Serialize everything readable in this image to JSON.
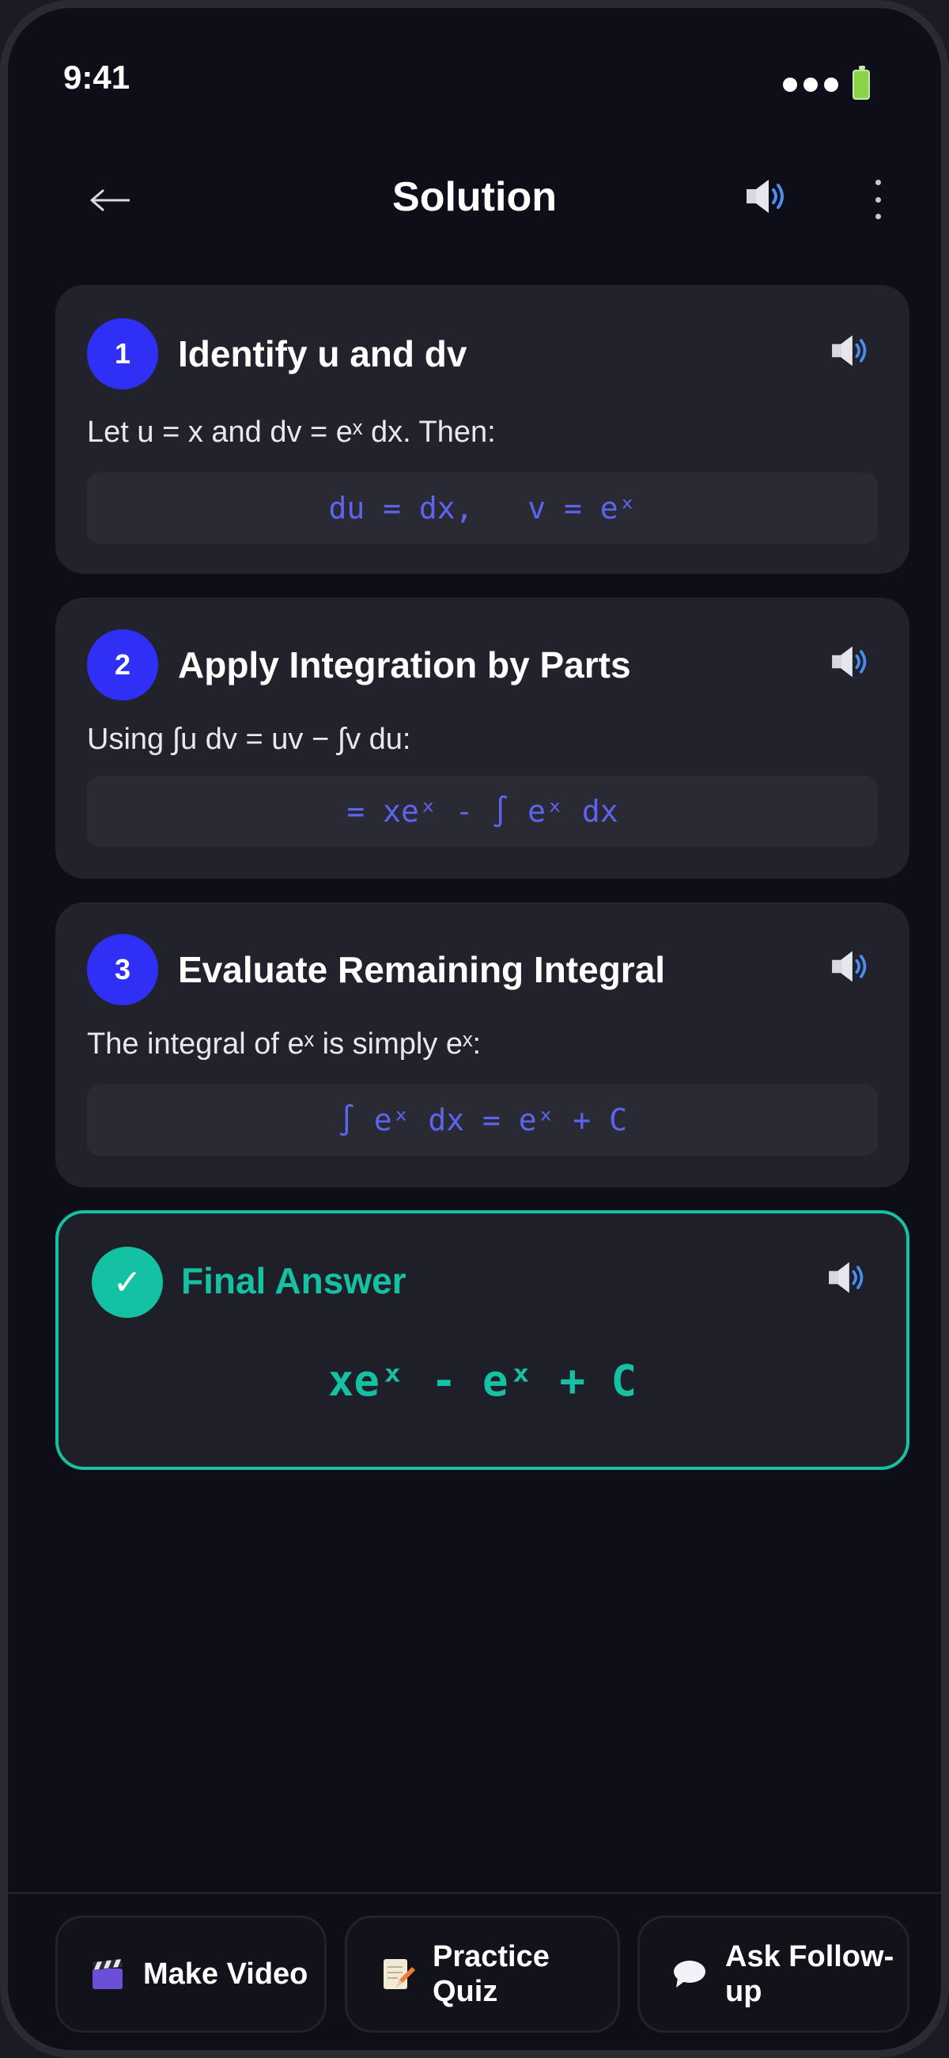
{
  "status": {
    "time": "9:41"
  },
  "header": {
    "title": "Solution",
    "back_icon": "back-arrow-icon",
    "audio_icon": "speaker-icon",
    "menu_icon": "more-vertical-icon"
  },
  "steps": [
    {
      "number": "1",
      "title": "Identify u and dv",
      "text": "Let u = x and dv = eˣ dx. Then:",
      "formula": "du = dx,   v = eˣ"
    },
    {
      "number": "2",
      "title": "Apply Integration by Parts",
      "text": "Using ∫u dv = uv − ∫v du:",
      "formula": "= xeˣ - ∫ eˣ dx"
    },
    {
      "number": "3",
      "title": "Evaluate Remaining Integral",
      "text": "The integral of eˣ is simply eˣ:",
      "formula": "∫ eˣ dx = eˣ + C"
    }
  ],
  "final": {
    "check": "✓",
    "title": "Final Answer",
    "formula": "xeˣ - eˣ + C"
  },
  "actions": [
    {
      "label_line1": "Make Video",
      "label_line2": "",
      "icon": "clapperboard-icon"
    },
    {
      "label_line1": "Practice",
      "label_line2": "Quiz",
      "icon": "memo-icon"
    },
    {
      "label_line1": "Ask Follow-",
      "label_line2": "up",
      "icon": "speech-bubble-icon"
    }
  ],
  "colors": {
    "accent": "#2f2ff5",
    "success": "#14c2a3",
    "formula": "#5d64f0",
    "card": "#22222d",
    "background": "#0e0e19"
  }
}
